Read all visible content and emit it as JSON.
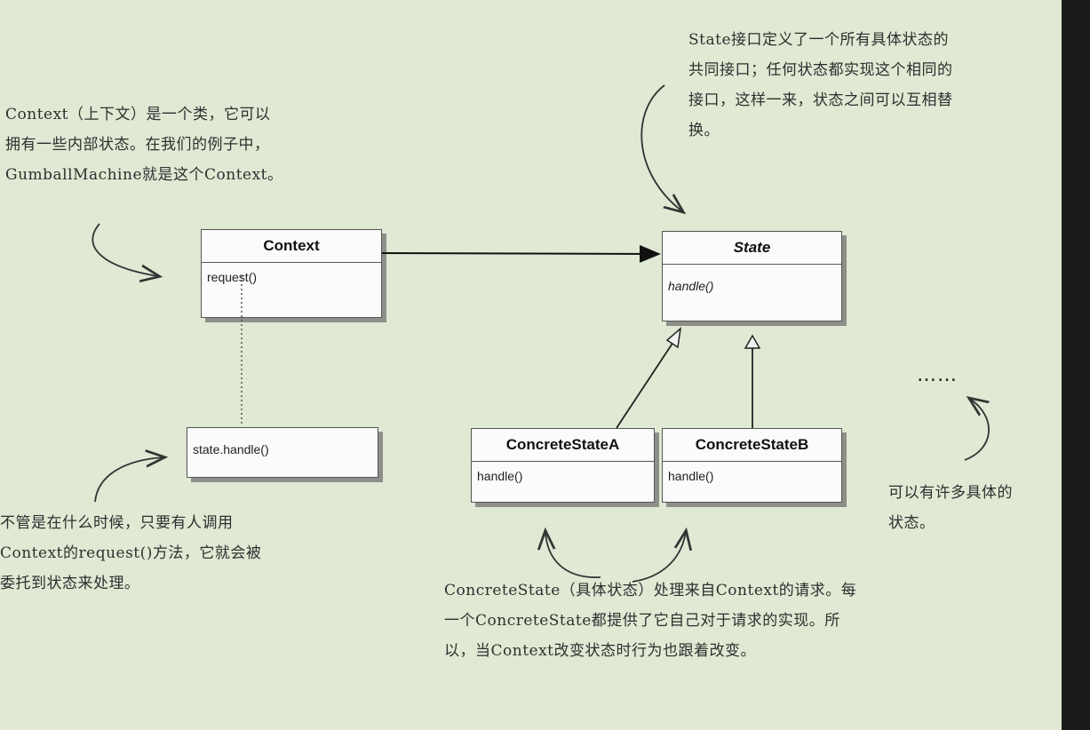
{
  "notes": {
    "context_note": "Context（上下文）是一个类，它可以\n拥有一些内部状态。在我们的例子中，\nGumballMachine就是这个Context。",
    "state_note": "State接口定义了一个所有具体状态的\n共同接口；任何状态都实现这个相同的\n接口，这样一来，状态之间可以互相替\n换。",
    "request_note": "不管是在什么时候，只要有人调用\nContext的request()方法，它就会被\n委托到状态来处理。",
    "concrete_note": "ConcreteState（具体状态）处理来自Context的请求。每\n一个ConcreteState都提供了它自己对于请求的实现。所\n以，当Context改变状态时行为也跟着改变。",
    "many_states_note": "可以有许多具体的\n状态。"
  },
  "boxes": {
    "context": {
      "title": "Context",
      "method": "request()"
    },
    "state": {
      "title": "State",
      "method": "handle()"
    },
    "state_handle": {
      "text": "state.handle()"
    },
    "concrete_a": {
      "title": "ConcreteStateA",
      "method": "handle()"
    },
    "concrete_b": {
      "title": "ConcreteStateB",
      "method": "handle()"
    }
  },
  "ellipsis": "……"
}
